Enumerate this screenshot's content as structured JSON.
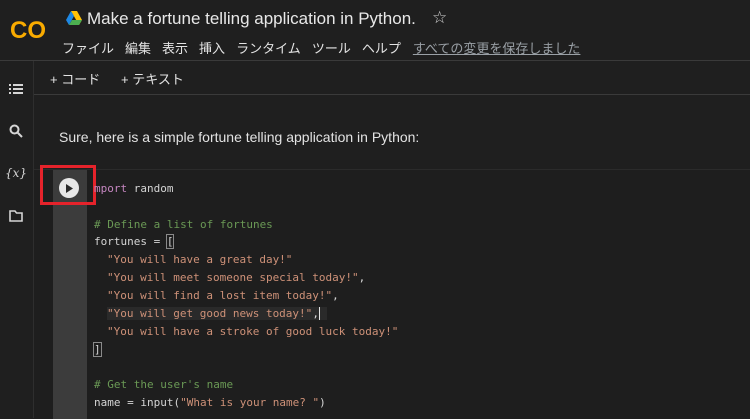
{
  "app": {
    "logo_text": "CO",
    "title": "Make a fortune telling application in Python.",
    "colors": {
      "logo_orange": "#F9AB00",
      "logo_dark_orange": "#E8710A",
      "highlight_red": "#E5232B"
    }
  },
  "menu": {
    "items": [
      "ファイル",
      "編集",
      "表示",
      "挿入",
      "ランタイム",
      "ツール",
      "ヘルプ"
    ],
    "saved_status": "すべての変更を保存しました"
  },
  "toolbar": {
    "add_code": "+ コード",
    "add_text": "+ テキスト"
  },
  "sidebar": {
    "icons": [
      "table-of-contents-icon",
      "search-icon",
      "variables-icon",
      "files-icon"
    ],
    "variables_label": "{x}"
  },
  "text_cell": {
    "text": "Sure, here is a simple fortune telling application in Python:"
  },
  "code_cell": {
    "line1_kw": "mport",
    "line1_rest": " random",
    "comment1": "# Define a list of fortunes",
    "fortunes_assign": "fortunes = ",
    "open_bracket": "[",
    "fortunes": [
      "\"You will have a great day!\"",
      "\"You will meet someone special today!\"",
      "\"You will find a lost item today!\"",
      "\"You will get good news today!\"",
      "\"You will have a stroke of good luck today!\""
    ],
    "close_bracket": "]",
    "comment2": "# Get the user's name",
    "name_assign": "name = input(",
    "name_prompt": "\"What is your name? \"",
    "name_close": ")"
  }
}
